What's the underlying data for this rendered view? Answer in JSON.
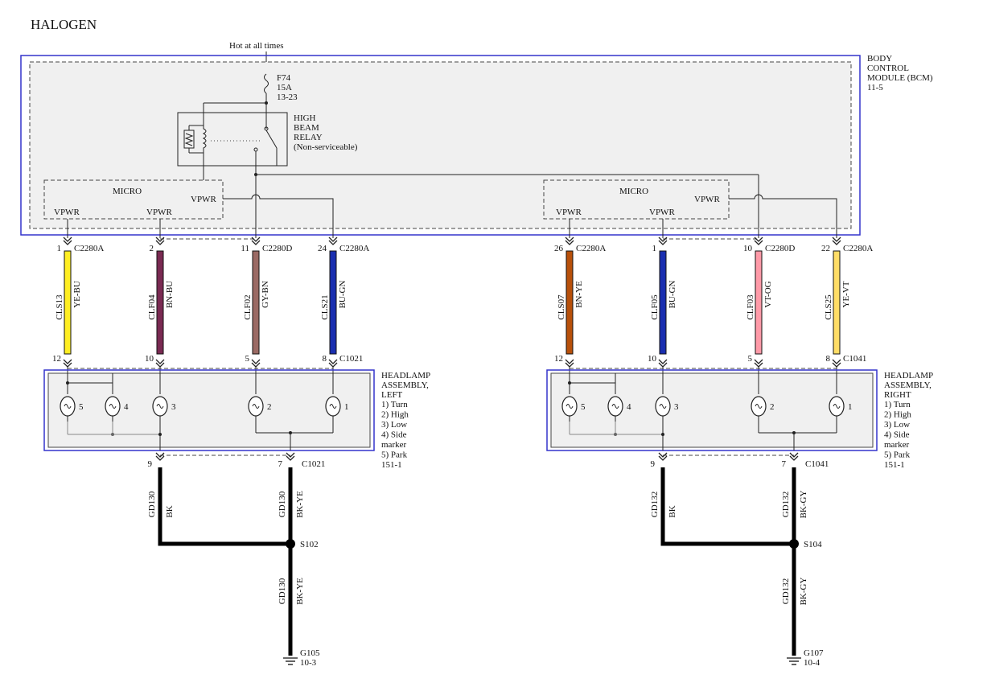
{
  "title": "HALOGEN",
  "supply": "Hot at all times",
  "colors": {
    "module_border": "#3333cc",
    "panel_fill": "#f0f0f0",
    "ground": "#000000"
  },
  "bcm": {
    "line1": "BODY",
    "line2": "CONTROL",
    "line3": "MODULE (BCM)",
    "ref": "11-5"
  },
  "fuse": {
    "name": "F74",
    "rating": "15A",
    "ref": "13-23"
  },
  "relay": {
    "line1": "HIGH",
    "line2": "BEAM",
    "line3": "RELAY",
    "line4": "(Non-serviceable)"
  },
  "micro_label": "MICRO",
  "vpwr_label": "VPWR",
  "wires_top": [
    {
      "pin": "1",
      "connector": "C2280A",
      "circuit": "CLS13",
      "color_code": "YE-BU",
      "color": "#ffee22",
      "bottom_pin": "12",
      "bottom_connector": ""
    },
    {
      "pin": "2",
      "connector": "",
      "circuit": "CLF04",
      "color_code": "BN-BU",
      "color": "#7a2a52",
      "bottom_pin": "10",
      "bottom_connector": ""
    },
    {
      "pin": "11",
      "connector": "C2280D",
      "circuit": "CLF02",
      "color_code": "GY-BN",
      "color": "#9b6a64",
      "bottom_pin": "5",
      "bottom_connector": ""
    },
    {
      "pin": "24",
      "connector": "C2280A",
      "circuit": "CLS21",
      "color_code": "BU-GN",
      "color": "#1a2fb0",
      "bottom_pin": "8",
      "bottom_connector": "C1021"
    },
    {
      "pin": "26",
      "connector": "C2280A",
      "circuit": "CLS07",
      "color_code": "BN-YE",
      "color": "#b8500a",
      "bottom_pin": "12",
      "bottom_connector": ""
    },
    {
      "pin": "1",
      "connector": "",
      "circuit": "CLF05",
      "color_code": "BU-GN",
      "color": "#1a2fb0",
      "bottom_pin": "10",
      "bottom_connector": ""
    },
    {
      "pin": "10",
      "connector": "C2280D",
      "circuit": "CLF03",
      "color_code": "VT-OG",
      "color": "#ff9aa8",
      "bottom_pin": "5",
      "bottom_connector": ""
    },
    {
      "pin": "22",
      "connector": "C2280A",
      "circuit": "CLS25",
      "color_code": "YE-VT",
      "color": "#ffdd66",
      "bottom_pin": "8",
      "bottom_connector": "C1041"
    }
  ],
  "headlamps": [
    {
      "line1": "HEADLAMP",
      "line2": "ASSEMBLY,",
      "line3": "LEFT",
      "items": [
        "1) Turn",
        "2) High",
        "3) Low",
        "4) Side",
        "marker",
        "5) Park"
      ],
      "ref": "151-1",
      "bulbs": [
        "5",
        "4",
        "3",
        "2",
        "1"
      ]
    },
    {
      "line1": "HEADLAMP",
      "line2": "ASSEMBLY,",
      "line3": "RIGHT",
      "items": [
        "1) Turn",
        "2) High",
        "3) Low",
        "4) Side",
        "marker",
        "5) Park"
      ],
      "ref": "151-1",
      "bulbs": [
        "5",
        "4",
        "3",
        "2",
        "1"
      ]
    }
  ],
  "grounds_left": {
    "pin_a": "9",
    "pin_b": "7",
    "connector": "C1021",
    "circuit": "GD130",
    "code_a": "BK",
    "code_b": "BK-YE",
    "splice": "S102",
    "ground": "G105",
    "ground_ref": "10-3"
  },
  "grounds_right": {
    "pin_a": "9",
    "pin_b": "7",
    "connector": "C1041",
    "circuit": "GD132",
    "code_a": "BK",
    "code_b": "BK-GY",
    "splice": "S104",
    "ground": "G107",
    "ground_ref": "10-4"
  }
}
